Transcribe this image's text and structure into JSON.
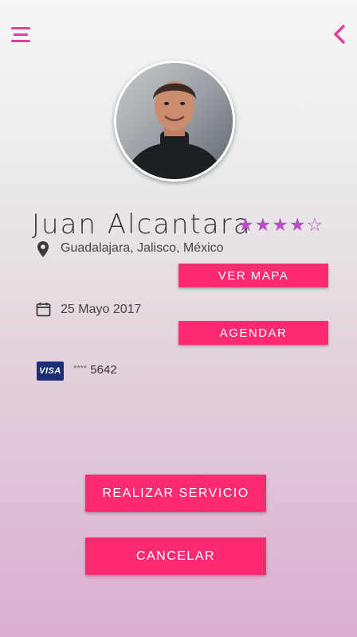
{
  "header": {
    "menu_icon": "hamburger-menu-icon",
    "back_icon": "chevron-left-icon",
    "accent_color": "#e0409a"
  },
  "profile": {
    "name": "Juan Alcantara",
    "rating": 4,
    "rating_max": 5,
    "rating_color": "#b84fc4"
  },
  "location": {
    "icon": "location-pin-icon",
    "text": "Guadalajara, Jalisco, México",
    "button_label": "VER MAPA"
  },
  "date": {
    "icon": "calendar-icon",
    "text": "25 Mayo 2017",
    "button_label": "AGENDAR"
  },
  "payment": {
    "card_brand": "VISA",
    "masked_prefix": "****",
    "last_digits": "5642"
  },
  "actions": {
    "primary_label": "REALIZAR SERVICIO",
    "cancel_label": "CANCELAR",
    "button_color": "#ff2a72"
  }
}
